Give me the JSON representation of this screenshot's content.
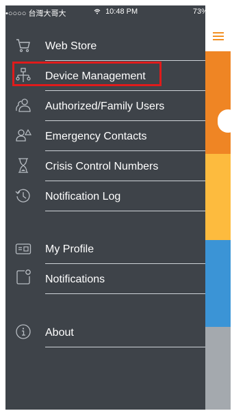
{
  "status_bar": {
    "carrier": "•○○○○ 台灣大哥大",
    "wifi_icon": "wifi-icon",
    "time": "10:48 PM",
    "battery_percent": "73%",
    "battery_level": 0.73
  },
  "menu": {
    "items": [
      {
        "label": "Web Store",
        "icon": "cart-icon"
      },
      {
        "label": "Device Management",
        "icon": "device-network-icon",
        "highlighted": true
      },
      {
        "label": "Authorized/Family Users",
        "icon": "users-icon"
      },
      {
        "label": "Emergency Contacts",
        "icon": "emergency-contact-icon"
      },
      {
        "label": "Crisis Control Numbers",
        "icon": "hourglass-icon"
      },
      {
        "label": "Notification Log",
        "icon": "history-clock-icon"
      },
      {
        "label": "My Profile",
        "icon": "profile-card-icon"
      },
      {
        "label": "Notifications",
        "icon": "notification-box-icon"
      },
      {
        "label": "About",
        "icon": "info-icon"
      }
    ]
  },
  "colors": {
    "menu_background": "#3e4349",
    "highlight_border": "#e01b1b",
    "accent_orange": "#ef8524",
    "accent_yellow": "#fdbb3e",
    "accent_blue": "#3b94d6",
    "accent_gray": "#a4a9ae"
  }
}
